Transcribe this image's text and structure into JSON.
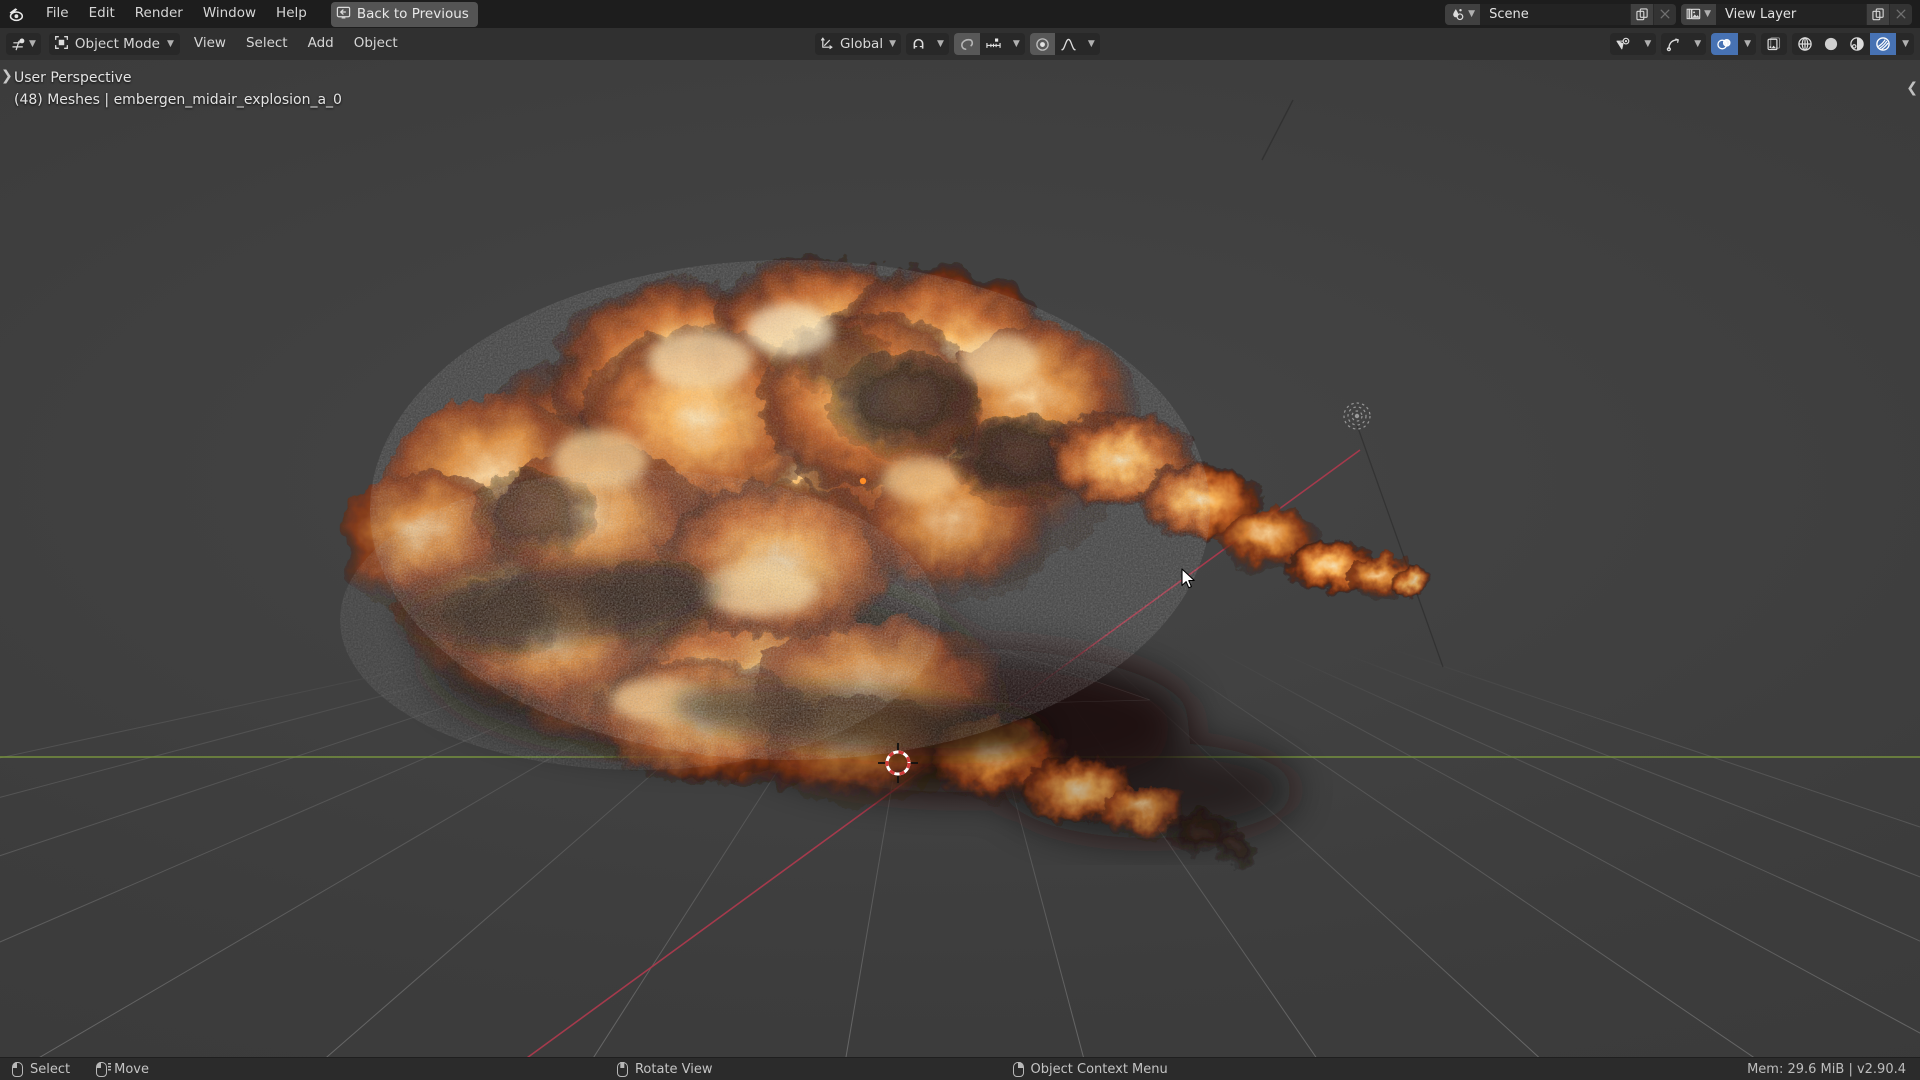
{
  "app": {
    "logo_icon": "blender-logo-icon",
    "version_label": "v2.90.4",
    "memory_label": "Mem: 29.6 MiB"
  },
  "topbar": {
    "menus": [
      {
        "label": "File",
        "name": "menu-file"
      },
      {
        "label": "Edit",
        "name": "menu-edit"
      },
      {
        "label": "Render",
        "name": "menu-render"
      },
      {
        "label": "Window",
        "name": "menu-window"
      },
      {
        "label": "Help",
        "name": "menu-help"
      }
    ],
    "back_button": {
      "label": "Back to Previous",
      "icon": "back-arrow-screen-icon"
    },
    "scene": {
      "icon": "scene-data-icon",
      "value": "Scene",
      "new_icon": "duplicate-icon",
      "unlink_icon": "close-x-icon"
    },
    "view_layer": {
      "icon": "view-layer-icon",
      "value": "View Layer",
      "new_icon": "duplicate-icon",
      "unlink_icon": "close-x-icon"
    }
  },
  "viewport_header": {
    "editor_type_icon": "editor-type-3dview-icon",
    "mode": {
      "icon": "object-mode-icon",
      "label": "Object Mode",
      "chevron": "chevron-down-icon"
    },
    "menus": [
      {
        "label": "View",
        "name": "vp-menu-view"
      },
      {
        "label": "Select",
        "name": "vp-menu-select"
      },
      {
        "label": "Add",
        "name": "vp-menu-add"
      },
      {
        "label": "Object",
        "name": "vp-menu-object"
      }
    ],
    "transform_orientation": {
      "icon": "transform-orientation-icon",
      "label": "Global",
      "chevron": "chevron-down-icon"
    },
    "snap": {
      "magnet_icon": "magnet-icon",
      "chevron": "chevron-down-icon"
    },
    "proportional": {
      "toggle_icon": "proportional-edit-icon",
      "mode_icon": "proportional-connected-icon",
      "falloff_icon": "smooth-falloff-curve-icon",
      "chevron": "chevron-down-icon"
    },
    "right_tools": {
      "visibility_icon": "object-types-visibility-icon",
      "gizmo_icon": "gizmo-icon",
      "overlays_icon": "overlays-icon",
      "xray_icon": "xray-toggle-icon",
      "shading": [
        {
          "icon": "wireframe-shading-icon",
          "active": false,
          "name": "shading-wireframe"
        },
        {
          "icon": "solid-shading-icon",
          "active": false,
          "name": "shading-solid"
        },
        {
          "icon": "material-preview-shading-icon",
          "active": false,
          "name": "shading-material"
        },
        {
          "icon": "rendered-shading-icon",
          "active": true,
          "name": "shading-rendered"
        }
      ],
      "shading_chevron": "chevron-down-icon"
    }
  },
  "viewport": {
    "perspective_label": "User Perspective",
    "object_info": "(48) Meshes | embergen_midair_explosion_a_0",
    "sidebar_toggle_icon": "chevron-right-icon",
    "n_panel_toggle_icon": "chevron-left-icon",
    "cursor_icon": "mouse-pointer-arrow",
    "objects": {
      "cursor_3d": "3d-cursor-icon",
      "light": "point-light-object",
      "origin_dot": "object-origin-dot"
    },
    "colors": {
      "background_top": "#464646",
      "background_bottom": "#363636",
      "grid_line": "#585858",
      "axis_x": "#a83a4a",
      "axis_y": "#6f8f3a",
      "fire_bright": "#ffd79a",
      "fire_mid": "#d8802f",
      "fire_dark": "#5e2a16",
      "smoke_dark": "#251713"
    }
  },
  "statusbar": {
    "hints": [
      {
        "label": "Select",
        "mouse": "lmb",
        "drag": false,
        "name": "status-hint-select"
      },
      {
        "label": "Move",
        "mouse": "lmb",
        "drag": true,
        "name": "status-hint-move"
      },
      {
        "label": "Rotate View",
        "mouse": "mmb",
        "drag": false,
        "name": "status-hint-rotate-view"
      },
      {
        "label": "Object Context Menu",
        "mouse": "rmb",
        "drag": false,
        "name": "status-hint-context-menu"
      }
    ],
    "right_text": "Mem: 29.6 MiB | v2.90.4"
  }
}
